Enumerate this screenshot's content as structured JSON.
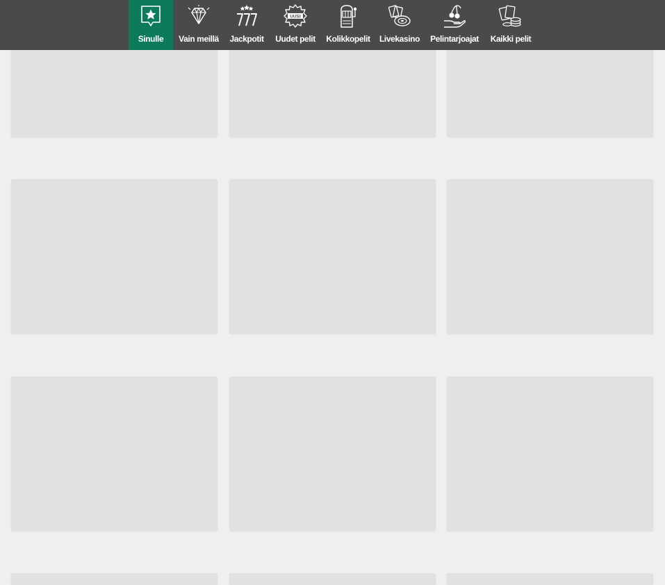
{
  "nav": {
    "items": [
      {
        "label": "Sinulle",
        "icon": "star-chat-icon",
        "active": true
      },
      {
        "label": "Vain meillä",
        "icon": "diamond-icon",
        "active": false
      },
      {
        "label": "Jackpotit",
        "icon": "lucky-777-icon",
        "active": false
      },
      {
        "label": "Uudet pelit",
        "icon": "new-badge-icon",
        "badge": "UUSI",
        "active": false
      },
      {
        "label": "Kolikkopelit",
        "icon": "slot-machine-icon",
        "active": false
      },
      {
        "label": "Livekasino",
        "icon": "roulette-cards-icon",
        "active": false
      },
      {
        "label": "Pelintarjoajat",
        "icon": "hand-cherries-icon",
        "active": false
      },
      {
        "label": "Kaikki pelit",
        "icon": "cards-chips-icon",
        "active": false
      }
    ],
    "colors": {
      "bar": "#4a4a4a",
      "active": "#0c7a5b",
      "text": "#ffffff"
    }
  },
  "games": {
    "placeholder_color": "#e1e1e1",
    "rows": 4,
    "columns": 3
  }
}
